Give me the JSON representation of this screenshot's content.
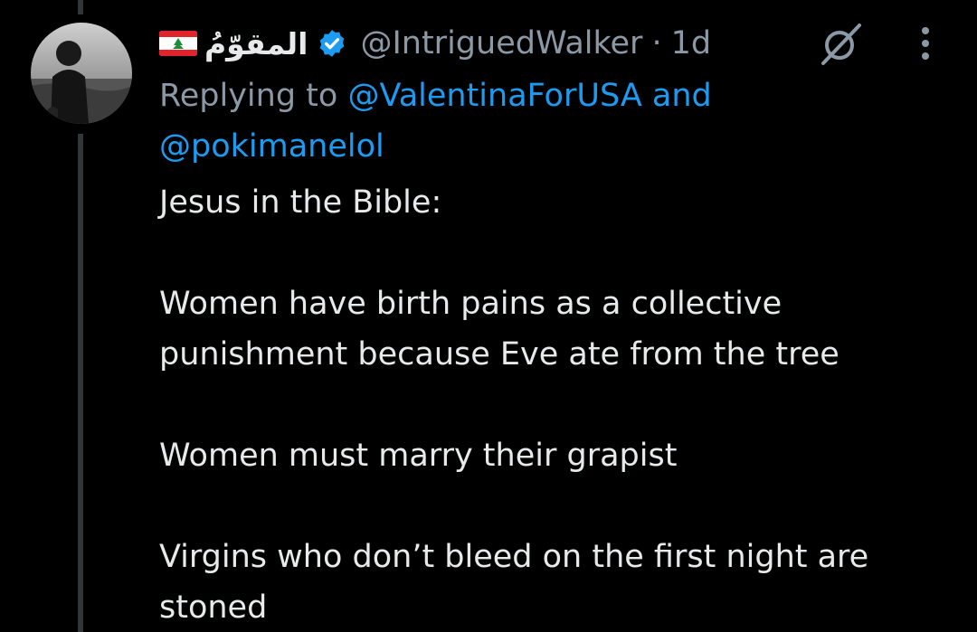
{
  "tweet": {
    "display_name": "المقوّمُ",
    "handle": "@IntriguedWalker",
    "separator": "·",
    "time": "1d",
    "flag_icon": "lebanon-flag-icon",
    "verified_icon": "verified-badge-icon",
    "reply": {
      "prefix": "Replying to",
      "mention_1": "@ValentinaForUSA",
      "conjunction": "and",
      "mention_2": "@pokimanelol"
    },
    "paragraphs": [
      "Jesus in the Bible:",
      "Women have birth pains as a collective punishment because Eve ate from the tree",
      "Women must marry their grapist",
      "Virgins who don’t bleed on the first night are stoned"
    ]
  },
  "actions": {
    "grok_icon": "grok-icon",
    "more_icon": "more-options-icon"
  },
  "colors": {
    "background": "#000000",
    "text": "#e7e9ea",
    "muted": "#8b98a5",
    "link": "#1d9bf0",
    "thread_line": "#333639"
  }
}
